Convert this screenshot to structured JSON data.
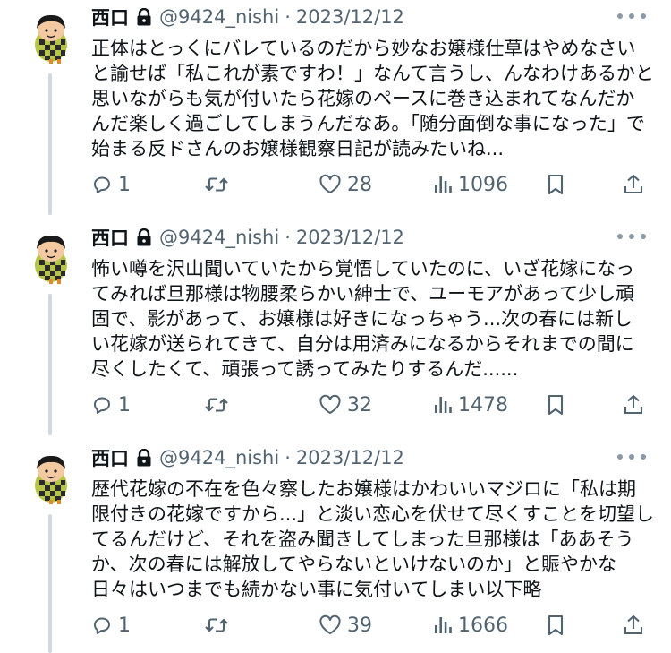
{
  "tweets": [
    {
      "name": "西口",
      "handle": "@9424_nishi",
      "separator": "·",
      "date": "2023/12/12",
      "lines": [
        "正体はとっくにバレているのだから妙なお嬢様仕草はやめなさい",
        "と諭せば「私これが素ですわ！」なんて言うし、んなわけあるかと",
        "思いながらも気が付いたら花嫁のペースに巻き込まれてなんだか",
        "んだ楽しく過ごしてしまうんだなあ。「随分面倒な事になった」で",
        "始まる反ドさんのお嬢様観察日記が読みたいね..."
      ],
      "replies": "1",
      "likes": "28",
      "views": "1096"
    },
    {
      "name": "西口",
      "handle": "@9424_nishi",
      "separator": "·",
      "date": "2023/12/12",
      "lines": [
        "怖い噂を沢山聞いていたから覚悟していたのに、いざ花嫁になっ",
        "てみれば旦那様は物腰柔らかい紳士で、ユーモアがあって少し頑",
        "固で、影があって、お嬢様は好きになっちゃう...次の春には新し",
        "い花嫁が送られてきて、自分は用済みになるからそれまでの間に",
        "尽くしたくて、頑張って誘ってみたりするんだ......"
      ],
      "replies": "1",
      "likes": "32",
      "views": "1478"
    },
    {
      "name": "西口",
      "handle": "@9424_nishi",
      "separator": "·",
      "date": "2023/12/12",
      "lines": [
        "歴代花嫁の不在を色々察したお嬢様はかわいいマジロに「私は期",
        "限付きの花嫁ですから...」と淡い恋心を伏せて尽くすことを切望し",
        "てるんだけど、それを盗み聞きしてしまった旦那様は「ああそう",
        "か、次の春には解放してやらないといけないのか」と賑やかな",
        "日々はいつまでも続かない事に気付いてしまい以下略"
      ],
      "replies": "1",
      "likes": "39",
      "views": "1666"
    }
  ],
  "icons": {
    "reply": "reply-icon",
    "retweet": "retweet-icon",
    "like": "like-icon",
    "views": "views-icon",
    "bookmark": "bookmark-icon",
    "share": "share-icon",
    "lock": "lock-icon",
    "more": "more-icon"
  },
  "colors": {
    "text": "#0f1419",
    "secondary": "#536471",
    "thread_line": "#cfd9de",
    "background": "#ffffff"
  }
}
